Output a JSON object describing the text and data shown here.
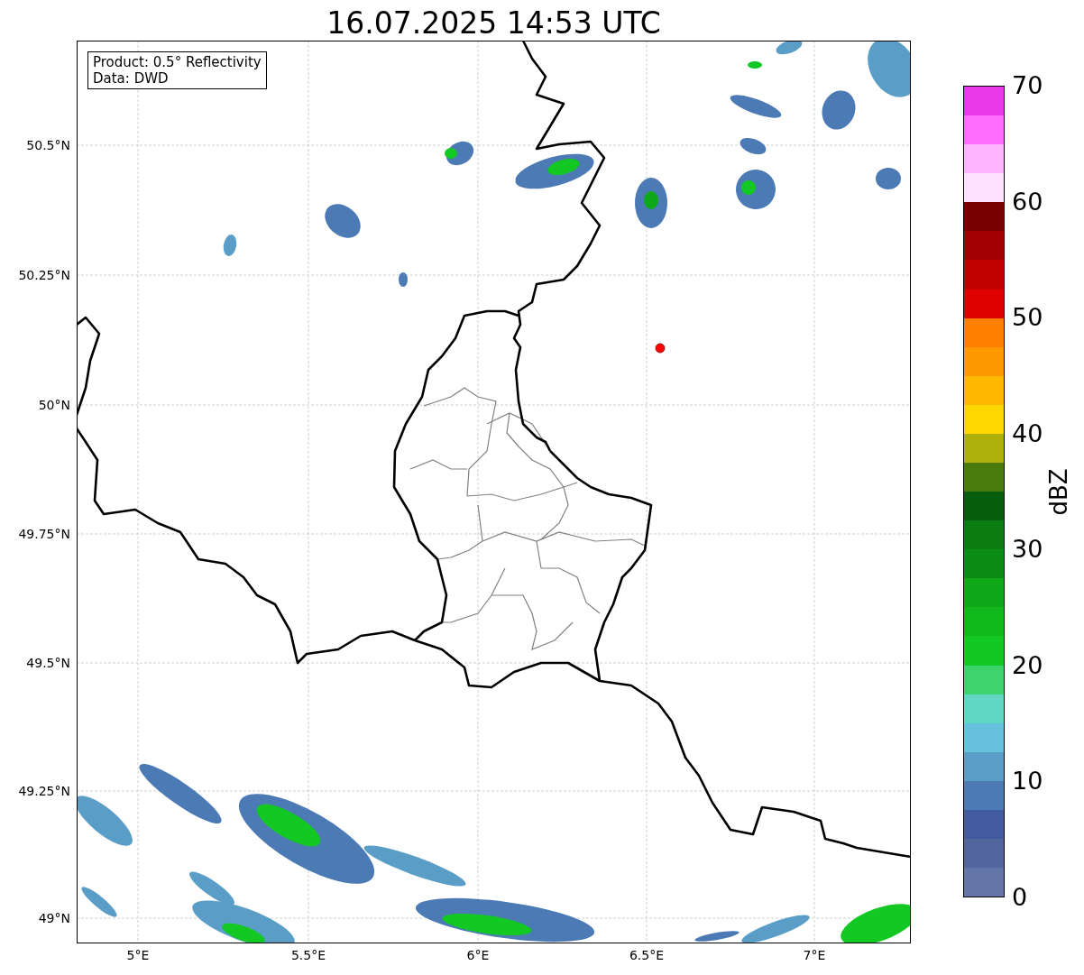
{
  "title": "16.07.2025 14:53 UTC",
  "info_box": [
    "Product: 0.5° Reflectivity",
    "Data: DWD"
  ],
  "map": {
    "lat_labels": [
      "50.5°N",
      "50.25°N",
      "50°N",
      "49.75°N",
      "49.5°N",
      "49.25°N",
      "49°N"
    ],
    "lon_labels": [
      "5°E",
      "5.5°E",
      "6°E",
      "6.5°E",
      "7°E"
    ]
  },
  "colorbar": {
    "label": "dBZ",
    "ticks": [
      "70",
      "60",
      "50",
      "40",
      "30",
      "20",
      "10",
      "0"
    ],
    "segments": [
      {
        "color": "#e838e8"
      },
      {
        "color": "#ff6cff"
      },
      {
        "color": "#ffb4ff"
      },
      {
        "color": "#ffe0ff"
      },
      {
        "color": "#7a0000"
      },
      {
        "color": "#a00000"
      },
      {
        "color": "#c10000"
      },
      {
        "color": "#e10000"
      },
      {
        "color": "#ff7f00"
      },
      {
        "color": "#ff9900"
      },
      {
        "color": "#ffb700"
      },
      {
        "color": "#ffd700"
      },
      {
        "color": "#b0b00a"
      },
      {
        "color": "#487a0c"
      },
      {
        "color": "#065e0c"
      },
      {
        "color": "#0a7c10"
      },
      {
        "color": "#0b8c14"
      },
      {
        "color": "#0ea818"
      },
      {
        "color": "#10b81c"
      },
      {
        "color": "#13c823"
      },
      {
        "color": "#3dd46e"
      },
      {
        "color": "#60d6c5"
      },
      {
        "color": "#66c1dc"
      },
      {
        "color": "#5a9ec8"
      },
      {
        "color": "#4b7ab5"
      },
      {
        "color": "#435ca0"
      },
      {
        "color": "#52659f"
      },
      {
        "color": "#6475a8"
      }
    ]
  }
}
